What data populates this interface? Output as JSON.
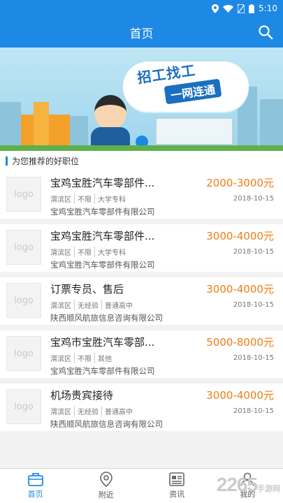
{
  "status_bar": {
    "time": "5:10"
  },
  "header": {
    "title": "首页"
  },
  "section": {
    "title": "为您推荐的好职位"
  },
  "banner": {
    "line1": "招工找工",
    "line2": "一网连通"
  },
  "jobs": [
    {
      "logo": "logo",
      "title": "宝鸡宝胜汽车零部件...",
      "salary": "2000-3000元",
      "tags": [
        "渭滨区",
        "不限",
        "大学专科"
      ],
      "date": "2018-10-15",
      "company": "宝鸡宝胜汽车零部件有限公司"
    },
    {
      "logo": "logo",
      "title": "宝鸡宝胜汽车零部件...",
      "salary": "3000-4000元",
      "tags": [
        "渭滨区",
        "不限",
        "大学专科"
      ],
      "date": "2018-10-15",
      "company": "宝鸡宝胜汽车零部件有限公司"
    },
    {
      "logo": "logo",
      "title": "订票专员、售后",
      "salary": "3000-4000元",
      "tags": [
        "渭滨区",
        "无经验",
        "普通高中"
      ],
      "date": "2018-10-15",
      "company": "陕西顺风航旅信息咨询有限公司"
    },
    {
      "logo": "logo",
      "title": "宝鸡市宝胜汽车零部...",
      "salary": "5000-8000元",
      "tags": [
        "渭滨区",
        "不限",
        "其他"
      ],
      "date": "2018-10-15",
      "company": "宝鸡宝胜汽车零部件有限公司"
    },
    {
      "logo": "logo",
      "title": "机场贵宾接待",
      "salary": "3000-4000元",
      "tags": [
        "渭滨区",
        "无经验",
        "普通高中"
      ],
      "date": "2018-10-15",
      "company": "陕西顺风航旅信息咨询有限公司"
    }
  ],
  "bottom_nav": [
    {
      "label": "首页",
      "icon": "briefcase-icon",
      "active": true
    },
    {
      "label": "附近",
      "icon": "location-pin-icon",
      "active": false
    },
    {
      "label": "资讯",
      "icon": "newspaper-icon",
      "active": false
    },
    {
      "label": "我的",
      "icon": "user-icon",
      "active": false
    }
  ],
  "watermark": {
    "text": "2265",
    "sub": "手游网"
  },
  "colors": {
    "primary": "#1e88e5",
    "salary": "#ef7d12"
  }
}
